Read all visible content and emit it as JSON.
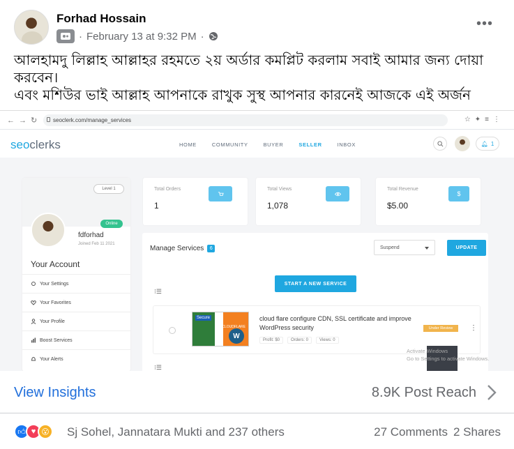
{
  "post": {
    "author": "Forhad Hossain",
    "timestamp": "February 13 at 9:32 PM",
    "separator": "·",
    "text_lines": [
      "আলহামদু লিল্লাহ আল্লাহর রহমতে ২য় অর্ডার কমপ্লিট করলাম সবাই আমার জন্য  দোয়া",
      "করবেন।",
      "এবং মশিউর ভাই আল্লাহ আপনাকে রাখুক সুস্থ  আপনার কারনেই আজকে এই অর্জন"
    ],
    "icons": {
      "group": "group-icon",
      "audience": "globe-icon",
      "more": "more-icon"
    }
  },
  "screenshot": {
    "browser": {
      "url": "seoclerk.com/manage_services"
    },
    "site": {
      "logo_a": "seo",
      "logo_b": "clerks",
      "nav": [
        "HOME",
        "COMMUNITY",
        "BUYER",
        "SELLER",
        "INBOX"
      ],
      "active_nav": "SELLER",
      "notif_count": "1"
    },
    "profile": {
      "level": "Level 1",
      "status": "Online",
      "username": "fdforhad",
      "joined": "Joined Feb 11 2021",
      "section_title": "Your Account",
      "menu": [
        "Your Settings",
        "Your Favorites",
        "Your Profile",
        "Boost Services",
        "Your Alerts"
      ]
    },
    "stats": [
      {
        "label": "Total Orders",
        "value": "1"
      },
      {
        "label": "Total Views",
        "value": "1,078"
      },
      {
        "label": "Total Revenue",
        "value": "$5.00"
      }
    ],
    "manage": {
      "title": "Manage Services",
      "count": "6",
      "filter_value": "Suspend",
      "update_label": "UPDATE",
      "start_label": "START A NEW SERVICE",
      "service": {
        "title": "cloud flare configure CDN, SSL certificate and improve WordPress security",
        "profit": "Profit: $0",
        "orders": "Orders: 0",
        "views": "Views: 0",
        "status": "Under Review",
        "thumb_secure": "Secure",
        "thumb_brand": "CLOUDFLARE"
      }
    },
    "windows_watermark": [
      "Activate Windows",
      "Go to Settings to activate Windows."
    ]
  },
  "footer": {
    "insights_label": "View Insights",
    "reach": "8.9K Post Reach",
    "reactors": "Sj Sohel, Jannatara Mukti and 237 others",
    "comments": "27 Comments",
    "shares": "2 Shares"
  },
  "colors": {
    "link_blue": "#216fdb",
    "seo_blue": "#1fa7e0",
    "online_green": "#34c38f",
    "review_orange": "#f1b44c"
  }
}
